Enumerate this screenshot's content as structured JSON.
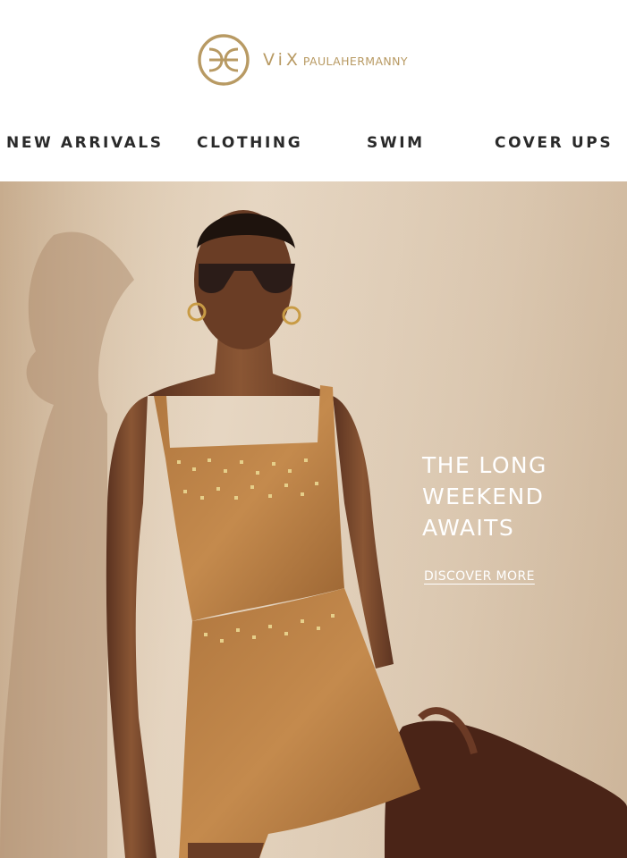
{
  "header": {
    "logo_vix": "ViX",
    "logo_brand": "PAULAHERMANNY",
    "logo_color": "#b89a63"
  },
  "nav": {
    "items": [
      "NEW ARRIVALS",
      "CLOTHING",
      "SWIM",
      "COVER UPS"
    ]
  },
  "hero": {
    "title": "THE LONG\nWEEKEND\nAWAITS",
    "cta_label": "DISCOVER MORE"
  }
}
